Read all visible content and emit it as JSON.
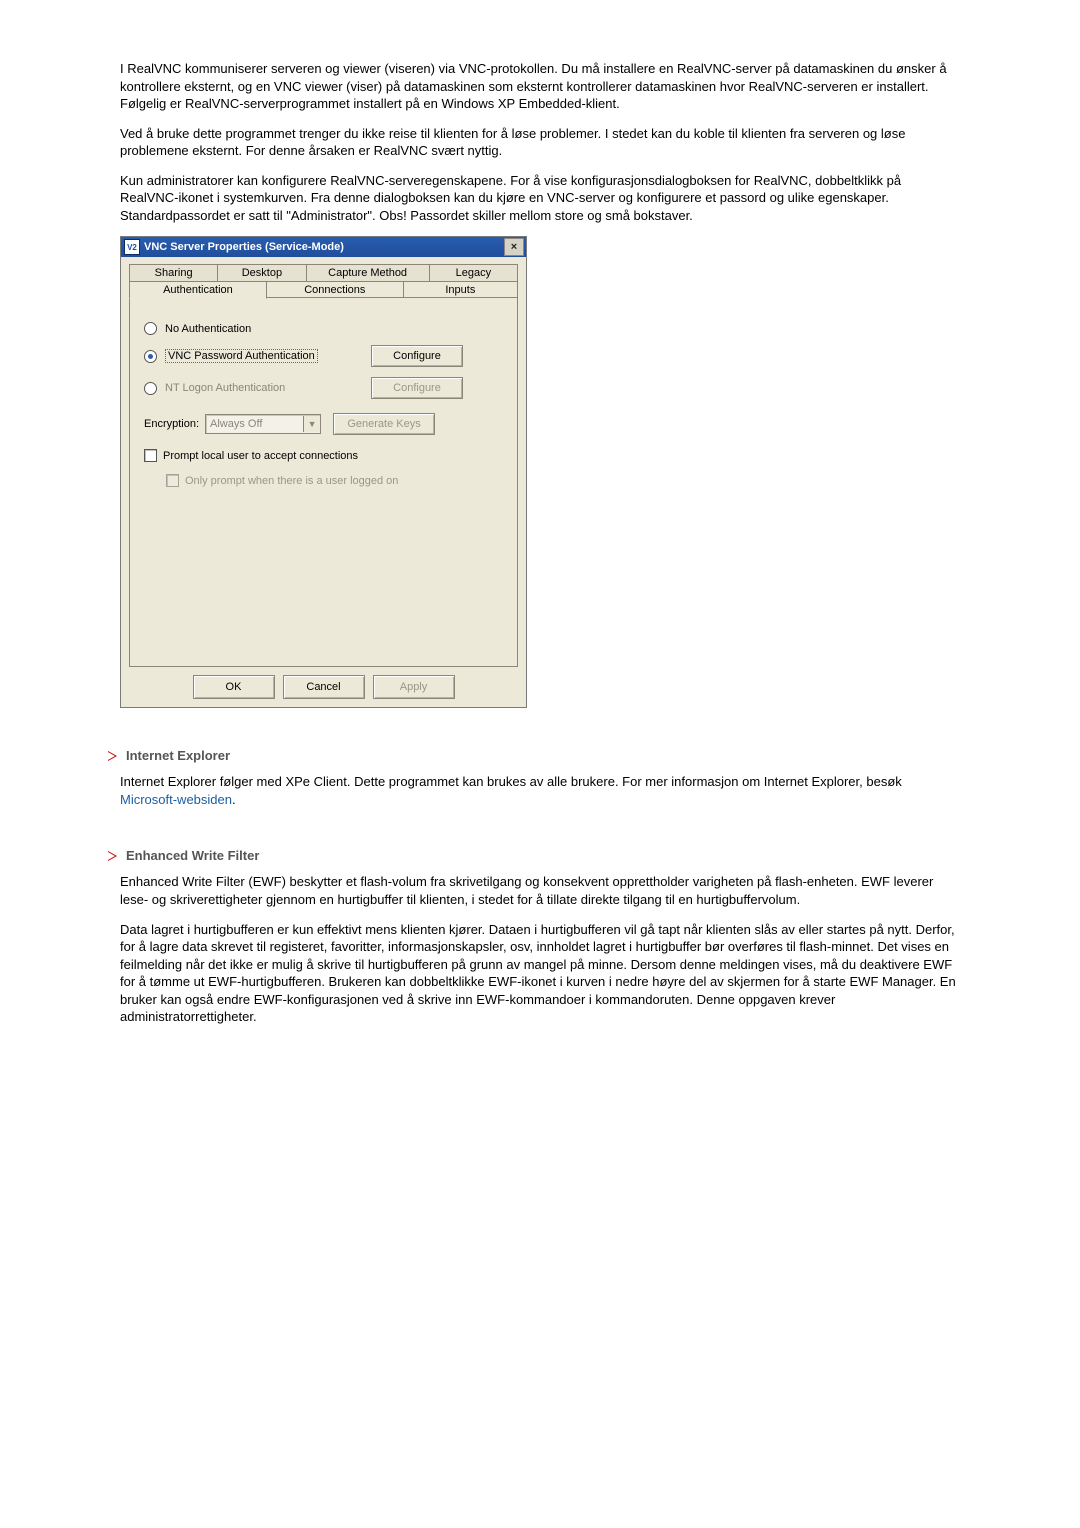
{
  "text": {
    "p1": "I RealVNC kommuniserer serveren og viewer (viseren) via VNC-protokollen. Du må installere en RealVNC-server på datamaskinen du ønsker å kontrollere eksternt, og en VNC viewer (viser) på datamaskinen som eksternt kontrollerer datamaskinen hvor RealVNC-serveren er installert. Følgelig er RealVNC-serverprogrammet installert på en Windows XP Embedded-klient.",
    "p2": "Ved å bruke dette programmet trenger du ikke reise til klienten for å løse problemer. I stedet kan du koble til klienten fra serveren og løse problemene eksternt. For denne årsaken er RealVNC svært nyttig.",
    "p3": "Kun administratorer kan konfigurere RealVNC-serveregenskapene. For å vise konfigurasjonsdialogboksen for RealVNC, dobbeltklikk på RealVNC-ikonet i systemkurven. Fra denne dialogboksen kan du kjøre en VNC-server og konfigurere et passord og ulike egenskaper. Standardpassordet er satt til \"Administrator\". Obs! Passordet skiller mellom store og små bokstaver.",
    "ie_head": "Internet Explorer",
    "ie_p1a": "Internet Explorer følger med XPe Client. Dette programmet kan brukes av alle brukere. For mer informasjon om Internet Explorer, besøk ",
    "ie_link": "Microsoft-websiden",
    "ie_p1b": ".",
    "ewf_head": "Enhanced Write Filter",
    "ewf_p1": "Enhanced Write Filter (EWF) beskytter et flash-volum fra skrivetilgang og konsekvent opprettholder varigheten på flash-enheten. EWF leverer lese- og skriverettigheter gjennom en hurtigbuffer til klienten, i stedet for å tillate direkte tilgang til en hurtigbuffervolum.",
    "ewf_p2": "Data lagret i hurtigbufferen er kun effektivt mens klienten kjører. Dataen i hurtigbufferen vil gå tapt når klienten slås av eller startes på nytt. Derfor, for å lagre data skrevet til registeret, favoritter, informasjonskapsler, osv, innholdet lagret i hurtigbuffer bør overføres til flash-minnet.  Det vises en feilmelding når det ikke er mulig å skrive til hurtigbufferen på grunn av mangel på minne. Dersom denne meldingen vises, må du deaktivere EWF for å tømme ut EWF-hurtigbufferen. Brukeren kan dobbeltklikke EWF-ikonet i kurven i nedre høyre del av skjermen for å starte EWF Manager. En bruker kan også endre EWF-konfigurasjonen ved å skrive inn EWF-kommandoer i kommandoruten. Denne oppgaven krever administratorrettigheter."
  },
  "dialog": {
    "appicon": "V2",
    "title": "VNC Server Properties (Service-Mode)",
    "close": "×",
    "tabs_back": [
      "Sharing",
      "Desktop",
      "Capture Method",
      "Legacy"
    ],
    "tabs_front": [
      "Authentication",
      "Connections",
      "Inputs"
    ],
    "opt_none": "No Authentication",
    "opt_vnc": "VNC Password Authentication",
    "opt_nt": "NT Logon Authentication",
    "btn_configure": "Configure",
    "enc_label": "Encryption:",
    "enc_value": "Always Off",
    "btn_genkeys": "Generate Keys",
    "chk_prompt": "Prompt local user to accept connections",
    "chk_onlyprompt": "Only prompt when there is a user logged on",
    "btn_ok": "OK",
    "btn_cancel": "Cancel",
    "btn_apply": "Apply"
  }
}
